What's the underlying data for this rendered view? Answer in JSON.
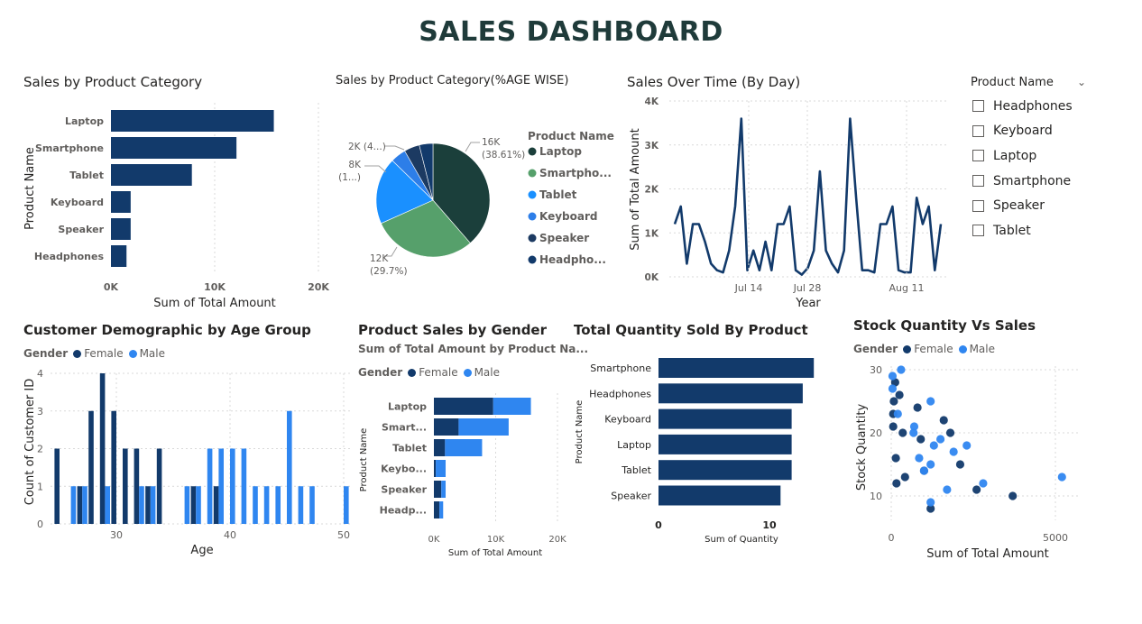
{
  "dashboard": {
    "title": "SALES DASHBOARD"
  },
  "colors": {
    "navy": "#123a6b",
    "dark_green": "#1b3f3b",
    "green": "#56a06b",
    "sky": "#1a90ff",
    "blue": "#2d7ee8",
    "dark_navy": "#1c3a62",
    "female": "#123a6b",
    "male": "#2f86f0"
  },
  "slicer": {
    "title": "Product Name",
    "chevron_icon": "chevron-down-icon",
    "items": [
      "Headphones",
      "Keyboard",
      "Laptop",
      "Smartphone",
      "Speaker",
      "Tablet"
    ]
  },
  "visuals": {
    "category_bar": {
      "title": "Sales by Product Category"
    },
    "category_pie": {
      "title": "Sales by Product Category(%AGE WISE)"
    },
    "sales_time": {
      "title": "Sales Over Time (By Day)"
    },
    "age_group": {
      "title": "Customer Demographic by Age Group"
    },
    "gender_sales": {
      "title": "Product Sales by Gender",
      "subtitle": "Sum of Total Amount by Product Na..."
    },
    "quantity_sold": {
      "title": "Total Quantity Sold By Product"
    },
    "stock_sales": {
      "title": "Stock Quantity Vs Sales"
    }
  },
  "chart_data": [
    {
      "id": "category_bar",
      "type": "bar",
      "orientation": "horizontal",
      "title": "Sales by Product Category",
      "categories": [
        "Laptop",
        "Smartphone",
        "Tablet",
        "Keyboard",
        "Speaker",
        "Headphones"
      ],
      "values": [
        15700,
        12100,
        7800,
        1900,
        1900,
        1500
      ],
      "xlabel": "Sum of Total Amount",
      "ylabel": "Product Name",
      "xlim": [
        0,
        20000
      ],
      "xticks": [
        "0K",
        "10K",
        "20K"
      ],
      "grid": true,
      "color": "#123a6b"
    },
    {
      "id": "category_pie",
      "type": "pie",
      "title": "Sales by Product Category(%AGE WISE)",
      "legend_title": "Product Name",
      "legend_labels": [
        "Laptop",
        "Smartpho...",
        "Tablet",
        "Keyboard",
        "Speaker",
        "Headpho..."
      ],
      "slices": [
        {
          "name": "Laptop",
          "value": 38.61,
          "color": "#1b3f3b"
        },
        {
          "name": "Smartphone",
          "value": 29.7,
          "color": "#56a06b"
        },
        {
          "name": "Tablet",
          "value": 19.0,
          "color": "#1a90ff"
        },
        {
          "name": "Keyboard",
          "value": 4.4,
          "color": "#2d7ee8"
        },
        {
          "name": "Speaker",
          "value": 4.4,
          "color": "#1c3a62"
        },
        {
          "name": "Headphones",
          "value": 3.89,
          "color": "#123a6b"
        }
      ],
      "labels": [
        {
          "lines": [
            "16K",
            "(38.61%)"
          ]
        },
        {
          "lines": [
            "12K",
            "(29.7%)"
          ]
        },
        {
          "lines": [
            "8K",
            "(1...)"
          ]
        },
        {
          "lines": [
            "2K (4...)"
          ]
        }
      ]
    },
    {
      "id": "sales_time",
      "type": "line",
      "title": "Sales Over Time (By Day)",
      "xlabel": "Year",
      "ylabel": "Sum of Total Amount",
      "xticks": [
        "Jul 14",
        "Jul 28",
        "Aug 11"
      ],
      "yticks": [
        "0K",
        "1K",
        "2K",
        "3K",
        "4K"
      ],
      "ylim": [
        0,
        4000
      ],
      "grid": true,
      "values": [
        1200,
        1600,
        300,
        1200,
        1200,
        800,
        300,
        150,
        100,
        600,
        1600,
        3600,
        150,
        600,
        150,
        800,
        150,
        1200,
        1200,
        1600,
        150,
        50,
        200,
        600,
        2400,
        600,
        300,
        100,
        600,
        3600,
        1800,
        150,
        150,
        100,
        1200,
        1200,
        1600,
        150,
        100,
        100,
        1800,
        1200,
        1600,
        150,
        1200
      ],
      "color": "#123a6b"
    },
    {
      "id": "age_group",
      "type": "bar",
      "title": "Customer Demographic by Age Group",
      "xlabel": "Age",
      "ylabel": "Count of Customer ID",
      "legend_title": "Gender",
      "legend": [
        "Female",
        "Male"
      ],
      "xticks": [
        "30",
        "40",
        "50"
      ],
      "yticks": [
        "0",
        "1",
        "2",
        "3",
        "4"
      ],
      "ylim": [
        0,
        4
      ],
      "series": [
        {
          "name": "Female",
          "points": [
            [
              25,
              2
            ],
            [
              27,
              1
            ],
            [
              28,
              3
            ],
            [
              29,
              4
            ],
            [
              30,
              3
            ],
            [
              31,
              2
            ],
            [
              32,
              2
            ],
            [
              33,
              1
            ],
            [
              34,
              2
            ],
            [
              37,
              1
            ],
            [
              39,
              1
            ]
          ]
        },
        {
          "name": "Male",
          "points": [
            [
              26,
              1
            ],
            [
              27,
              1
            ],
            [
              29,
              1
            ],
            [
              32,
              1
            ],
            [
              33,
              1
            ],
            [
              36,
              1
            ],
            [
              37,
              1
            ],
            [
              38,
              2
            ],
            [
              39,
              2
            ],
            [
              40,
              2
            ],
            [
              41,
              2
            ],
            [
              42,
              1
            ],
            [
              43,
              1
            ],
            [
              44,
              1
            ],
            [
              45,
              3
            ],
            [
              46,
              1
            ],
            [
              47,
              1
            ],
            [
              50,
              1
            ]
          ]
        }
      ]
    },
    {
      "id": "gender_sales",
      "type": "bar",
      "orientation": "horizontal",
      "stacked": true,
      "title": "Product Sales by Gender",
      "subtitle": "Sum of Total Amount by Product Na...",
      "xlabel": "Sum of Total Amount",
      "ylabel": "Product Name",
      "legend_title": "Gender",
      "legend": [
        "Female",
        "Male"
      ],
      "categories": [
        "Laptop",
        "Smart...",
        "Tablet",
        "Keybo...",
        "Speaker",
        "Headp..."
      ],
      "xticks": [
        "0K",
        "10K",
        "20K"
      ],
      "xlim": [
        0,
        20000
      ],
      "series": [
        {
          "name": "Female",
          "values": [
            9600,
            4000,
            1800,
            300,
            1200,
            900
          ]
        },
        {
          "name": "Male",
          "values": [
            6100,
            8100,
            6000,
            1600,
            700,
            600
          ]
        }
      ]
    },
    {
      "id": "quantity_sold",
      "type": "bar",
      "orientation": "horizontal",
      "title": "Total Quantity Sold By Product",
      "xlabel": "Sum of Quantity",
      "ylabel": "Product Name",
      "categories": [
        "Smartphone",
        "Headphones",
        "Keyboard",
        "Laptop",
        "Tablet",
        "Speaker"
      ],
      "values": [
        14,
        13,
        12,
        12,
        12,
        11
      ],
      "xticks": [
        "0",
        "10"
      ],
      "xlim": [
        0,
        15
      ],
      "color": "#123a6b"
    },
    {
      "id": "stock_sales",
      "type": "scatter",
      "title": "Stock Quantity Vs Sales",
      "xlabel": "Sum of Total Amount",
      "ylabel": "Stock Quantity",
      "legend_title": "Gender",
      "legend": [
        "Female",
        "Male"
      ],
      "xticks": [
        "0",
        "5000"
      ],
      "yticks": [
        "10",
        "20",
        "30"
      ],
      "xlim": [
        0,
        6000
      ],
      "ylim": [
        6,
        31
      ],
      "series": [
        {
          "name": "Female",
          "points": [
            [
              120,
              28
            ],
            [
              250,
              26
            ],
            [
              80,
              25
            ],
            [
              60,
              23
            ],
            [
              60,
              21
            ],
            [
              350,
              20
            ],
            [
              800,
              24
            ],
            [
              900,
              19
            ],
            [
              1600,
              22
            ],
            [
              1800,
              20
            ],
            [
              2100,
              15
            ],
            [
              1000,
              14
            ],
            [
              140,
              16
            ],
            [
              420,
              13
            ],
            [
              160,
              12
            ],
            [
              1200,
              8
            ],
            [
              2600,
              11
            ],
            [
              3700,
              10
            ]
          ]
        },
        {
          "name": "Male",
          "points": [
            [
              40,
              29
            ],
            [
              300,
              30
            ],
            [
              40,
              27
            ],
            [
              200,
              23
            ],
            [
              700,
              21
            ],
            [
              680,
              20
            ],
            [
              1200,
              25
            ],
            [
              1500,
              19
            ],
            [
              1300,
              18
            ],
            [
              1900,
              17
            ],
            [
              2300,
              18
            ],
            [
              850,
              16
            ],
            [
              1000,
              14
            ],
            [
              1200,
              15
            ],
            [
              1200,
              9
            ],
            [
              1700,
              11
            ],
            [
              2800,
              12
            ],
            [
              5200,
              13
            ]
          ]
        }
      ]
    }
  ]
}
